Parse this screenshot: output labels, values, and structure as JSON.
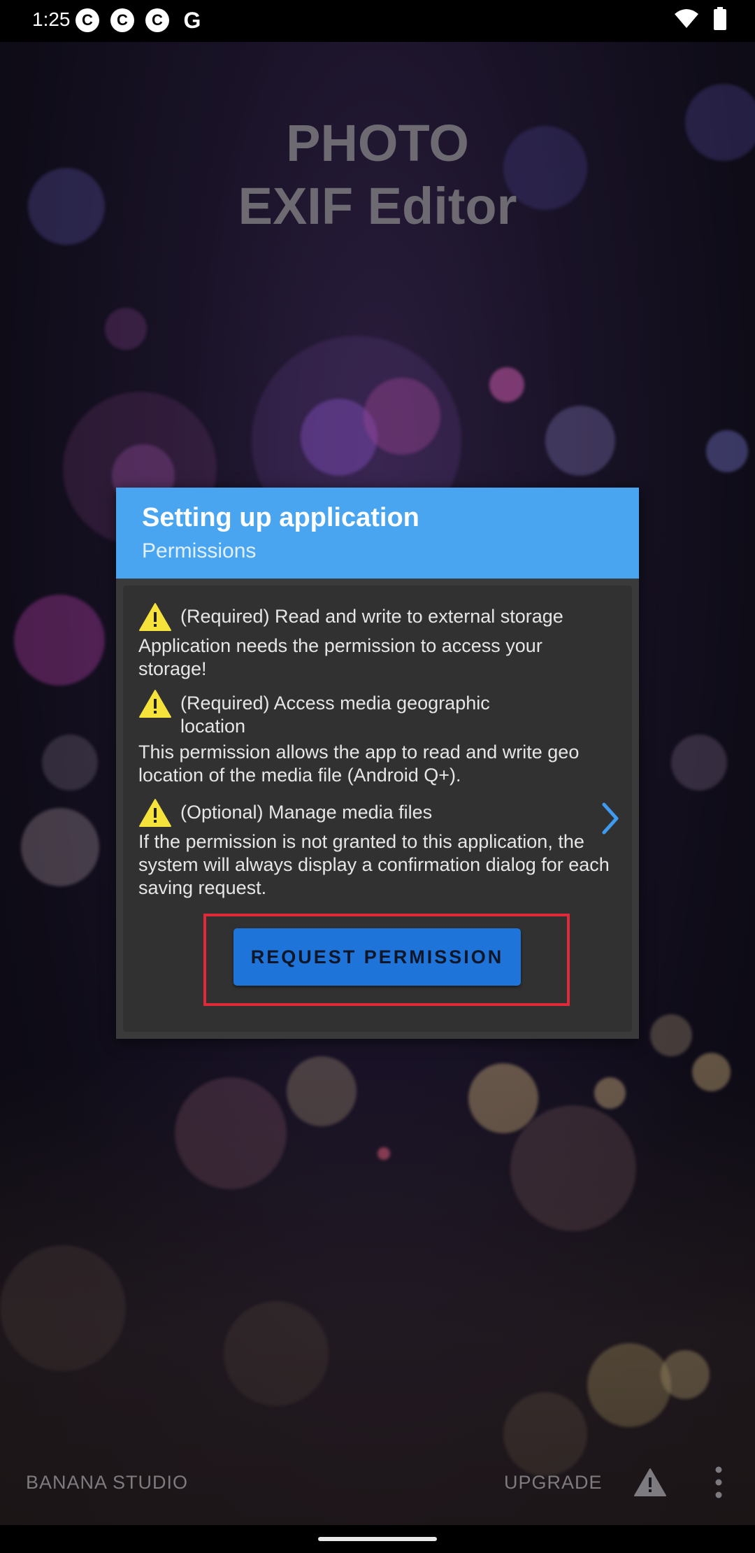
{
  "status_bar": {
    "time": "1:25",
    "notification_icons": [
      "c-icon",
      "c-icon",
      "c-icon",
      "google-icon"
    ],
    "right_icons": [
      "wifi-icon",
      "battery-icon"
    ]
  },
  "app": {
    "title_line1": "PHOTO",
    "title_line2": "EXIF Editor"
  },
  "dialog": {
    "title": "Setting up application",
    "subtitle": "Permissions",
    "permissions": [
      {
        "name": "(Required) Read and write to external storage",
        "description": "Application needs the permission to access your storage!",
        "icon": "warning-icon"
      },
      {
        "name": "(Required) Access media geographic location",
        "description": "This permission allows the app to read and write geo location of the media file (Android Q+).",
        "icon": "warning-icon"
      },
      {
        "name": "(Optional) Manage media files",
        "description": "If the permission is not granted to this application, the system will always display a confirmation dialog for each saving request.",
        "icon": "warning-icon",
        "has_chevron": true
      }
    ],
    "request_button_label": "REQUEST PERMISSION"
  },
  "bottom_bar": {
    "brand": "BANANA STUDIO",
    "upgrade_label": "UPGRADE"
  },
  "colors": {
    "dialog_header": "#4aa5f1",
    "button": "#1e74d8",
    "highlight": "#e02a3a",
    "warning": "#f5e23b"
  }
}
